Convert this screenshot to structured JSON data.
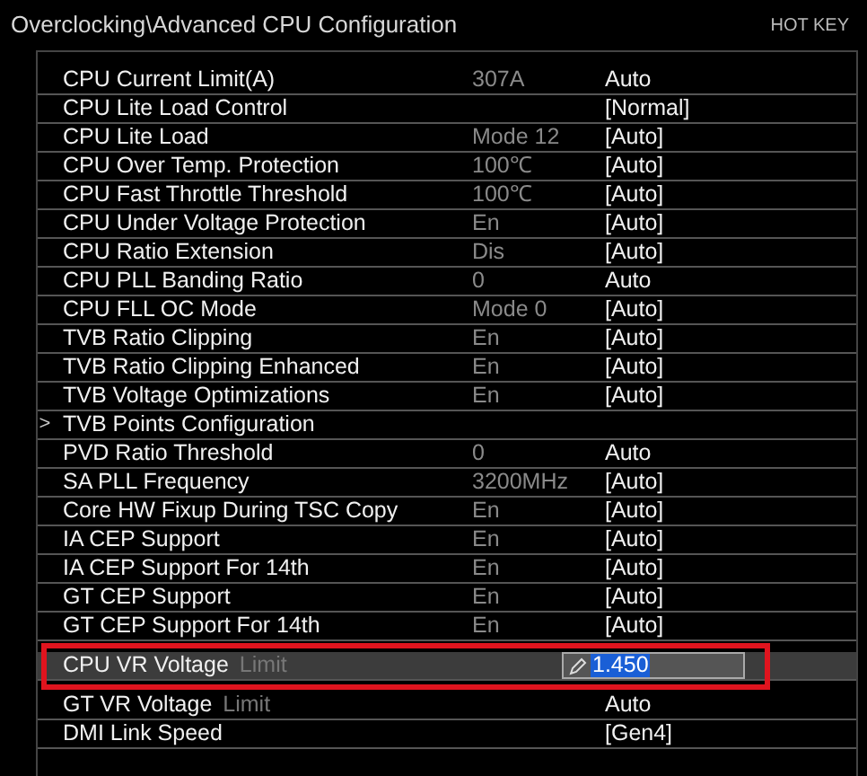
{
  "header": {
    "breadcrumb": "Overclocking\\Advanced CPU Configuration",
    "hot_key": "HOT KEY"
  },
  "rows": [
    {
      "kind": "setting",
      "label": "CPU Current Limit(A)",
      "current": "307A",
      "setting": "Auto",
      "selected": false
    },
    {
      "kind": "setting",
      "label": "CPU Lite Load Control",
      "setting": "[Normal]",
      "selected": false
    },
    {
      "kind": "setting",
      "label": "CPU Lite Load",
      "current": "Mode 12",
      "setting": "[Auto]",
      "selected": false
    },
    {
      "kind": "setting",
      "label": "CPU Over Temp. Protection",
      "current": "100℃",
      "setting": "[Auto]",
      "selected": false
    },
    {
      "kind": "setting",
      "label": "CPU Fast Throttle Threshold",
      "current": "100℃",
      "setting": "[Auto]",
      "selected": false
    },
    {
      "kind": "setting",
      "label": "CPU Under Voltage Protection",
      "current": "En",
      "setting": "[Auto]",
      "selected": false
    },
    {
      "kind": "setting",
      "label": "CPU Ratio Extension",
      "current": "Dis",
      "setting": "[Auto]",
      "selected": false
    },
    {
      "kind": "setting",
      "label": "CPU PLL Banding Ratio",
      "current": "0",
      "setting": "Auto",
      "selected": false
    },
    {
      "kind": "setting",
      "label": "CPU FLL OC Mode",
      "current": "Mode 0",
      "setting": "[Auto]",
      "selected": false
    },
    {
      "kind": "setting",
      "label": "TVB Ratio Clipping",
      "current": "En",
      "setting": "[Auto]",
      "selected": false
    },
    {
      "kind": "setting",
      "label": "TVB Ratio Clipping Enhanced",
      "current": "En",
      "setting": "[Auto]",
      "selected": false
    },
    {
      "kind": "setting",
      "label": "TVB Voltage Optimizations",
      "current": "En",
      "setting": "[Auto]",
      "selected": false
    },
    {
      "kind": "submenu",
      "label": "TVB Points Configuration",
      "marker": ">",
      "selected": false
    },
    {
      "kind": "setting",
      "label": "PVD Ratio Threshold",
      "current": "0",
      "setting": "Auto",
      "selected": false
    },
    {
      "kind": "setting",
      "label": "SA PLL Frequency",
      "current": "3200MHz",
      "setting": "[Auto]",
      "selected": false
    },
    {
      "kind": "setting",
      "label": "Core HW Fixup During TSC Copy",
      "current": "En",
      "setting": "[Auto]",
      "selected": false
    },
    {
      "kind": "setting",
      "label": "IA CEP Support",
      "current": "En",
      "setting": "[Auto]",
      "selected": false
    },
    {
      "kind": "setting",
      "label": "IA CEP Support For 14th",
      "current": "En",
      "setting": "[Auto]",
      "selected": false
    },
    {
      "kind": "setting",
      "label": "GT CEP Support",
      "current": "En",
      "setting": "[Auto]",
      "selected": false
    },
    {
      "kind": "setting",
      "label": "GT CEP Support For 14th",
      "current": "En",
      "setting": "[Auto]",
      "selected": false
    },
    {
      "kind": "edit",
      "label": "CPU VR Voltage",
      "suffix": "Limit",
      "value": "1.450",
      "selected": true
    },
    {
      "kind": "setting",
      "label": "GT VR Voltage",
      "suffix": "Limit",
      "setting": "Auto",
      "selected": false
    },
    {
      "kind": "setting",
      "label": "DMI Link Speed",
      "setting": "[Gen4]",
      "selected": false
    }
  ]
}
